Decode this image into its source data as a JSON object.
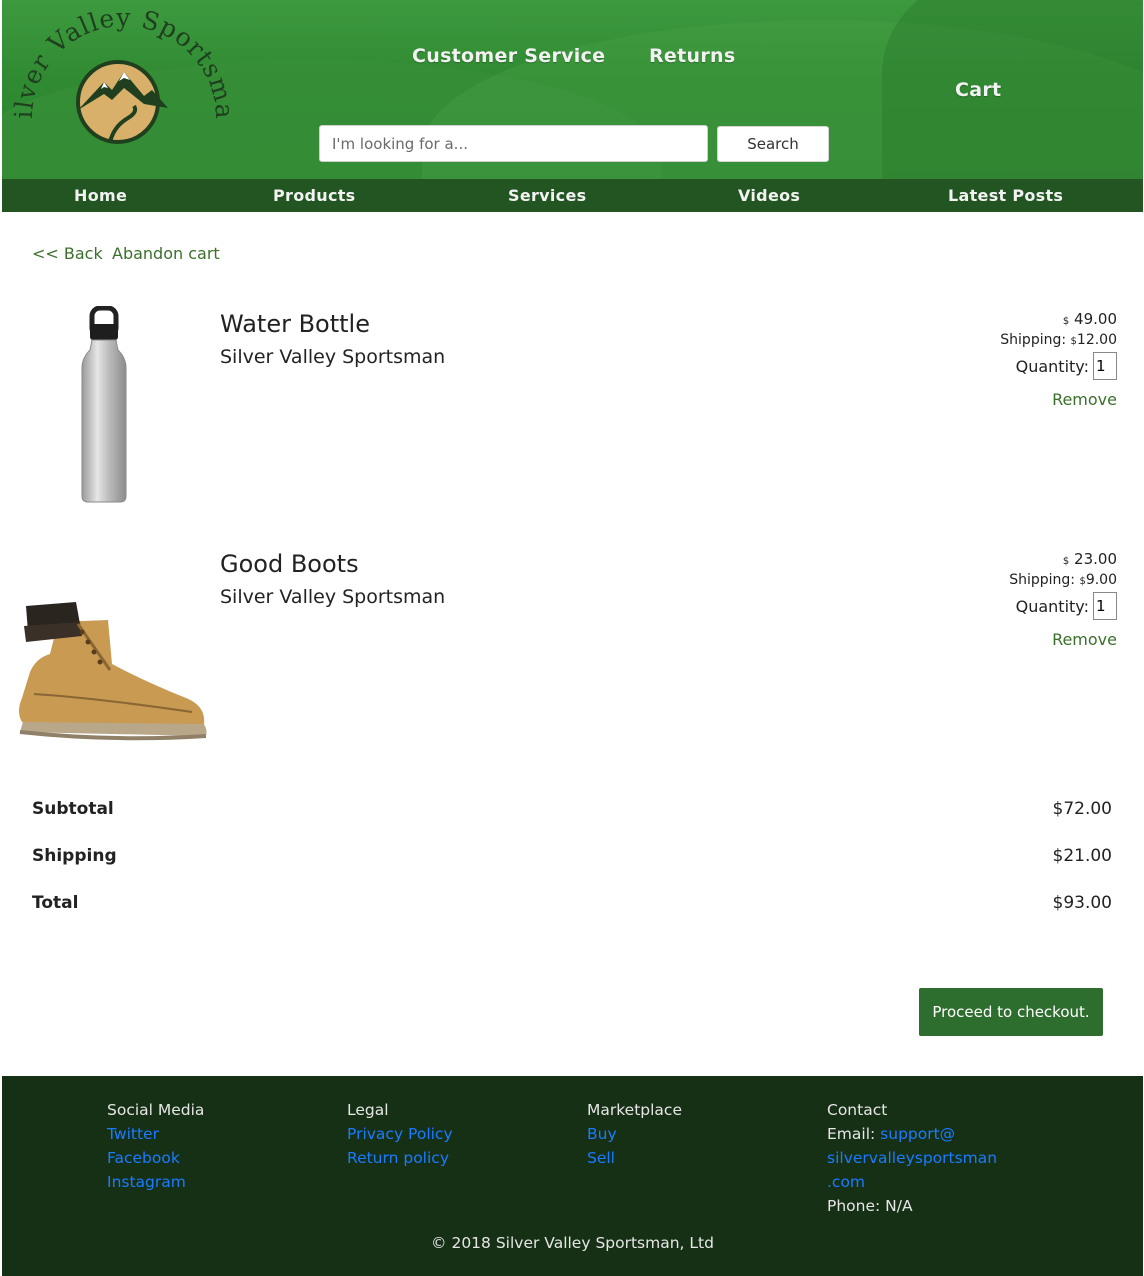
{
  "brand": {
    "name": "Silver Valley Sportsman"
  },
  "header": {
    "links": {
      "customer_service": "Customer Service",
      "returns": "Returns",
      "cart": "Cart"
    },
    "search": {
      "placeholder": "I'm looking for a...",
      "button": "Search"
    }
  },
  "nav": [
    "Home",
    "Products",
    "Services",
    "Videos",
    "Latest Posts"
  ],
  "breadcrumb": {
    "back": "<< Back",
    "abandon": "Abandon cart"
  },
  "cart": {
    "items": [
      {
        "title": "Water Bottle",
        "seller": "Silver Valley Sportsman",
        "currency": "$",
        "price": "49.00",
        "shipping_label": "Shipping:",
        "shipping": "12.00",
        "quantity_label": "Quantity:",
        "quantity": "1",
        "remove": "Remove",
        "image_icon": "water-bottle-image"
      },
      {
        "title": "Good Boots",
        "seller": "Silver Valley Sportsman",
        "currency": "$",
        "price": "23.00",
        "shipping_label": "Shipping:",
        "shipping": "9.00",
        "quantity_label": "Quantity:",
        "quantity": "1",
        "remove": "Remove",
        "image_icon": "boot-image"
      }
    ],
    "totals": {
      "subtotal_label": "Subtotal",
      "subtotal": "$72.00",
      "shipping_label": "Shipping",
      "shipping": "$21.00",
      "total_label": "Total",
      "total": "$93.00"
    },
    "checkout": "Proceed to checkout."
  },
  "footer": {
    "social": {
      "heading": "Social Media",
      "links": [
        "Twitter",
        "Facebook",
        "Instagram"
      ]
    },
    "legal": {
      "heading": "Legal",
      "links": [
        "Privacy Policy",
        "Return policy"
      ]
    },
    "marketplace": {
      "heading": "Marketplace",
      "links": [
        "Buy",
        "Sell"
      ]
    },
    "contact": {
      "heading": "Contact",
      "email_label": "Email:",
      "email_lines": [
        "support@",
        "silvervalleysportsman",
        ".com"
      ],
      "phone": "Phone: N/A"
    },
    "copyright": "© 2018 Silver Valley Sportsman, Ltd"
  },
  "colors": {
    "header_green": "#2f8a31",
    "nav_green": "#225522",
    "link_green": "#3b6f2c",
    "button_green": "#2d6e2e",
    "footer_bg": "#163016",
    "footer_link": "#1a7bff"
  }
}
